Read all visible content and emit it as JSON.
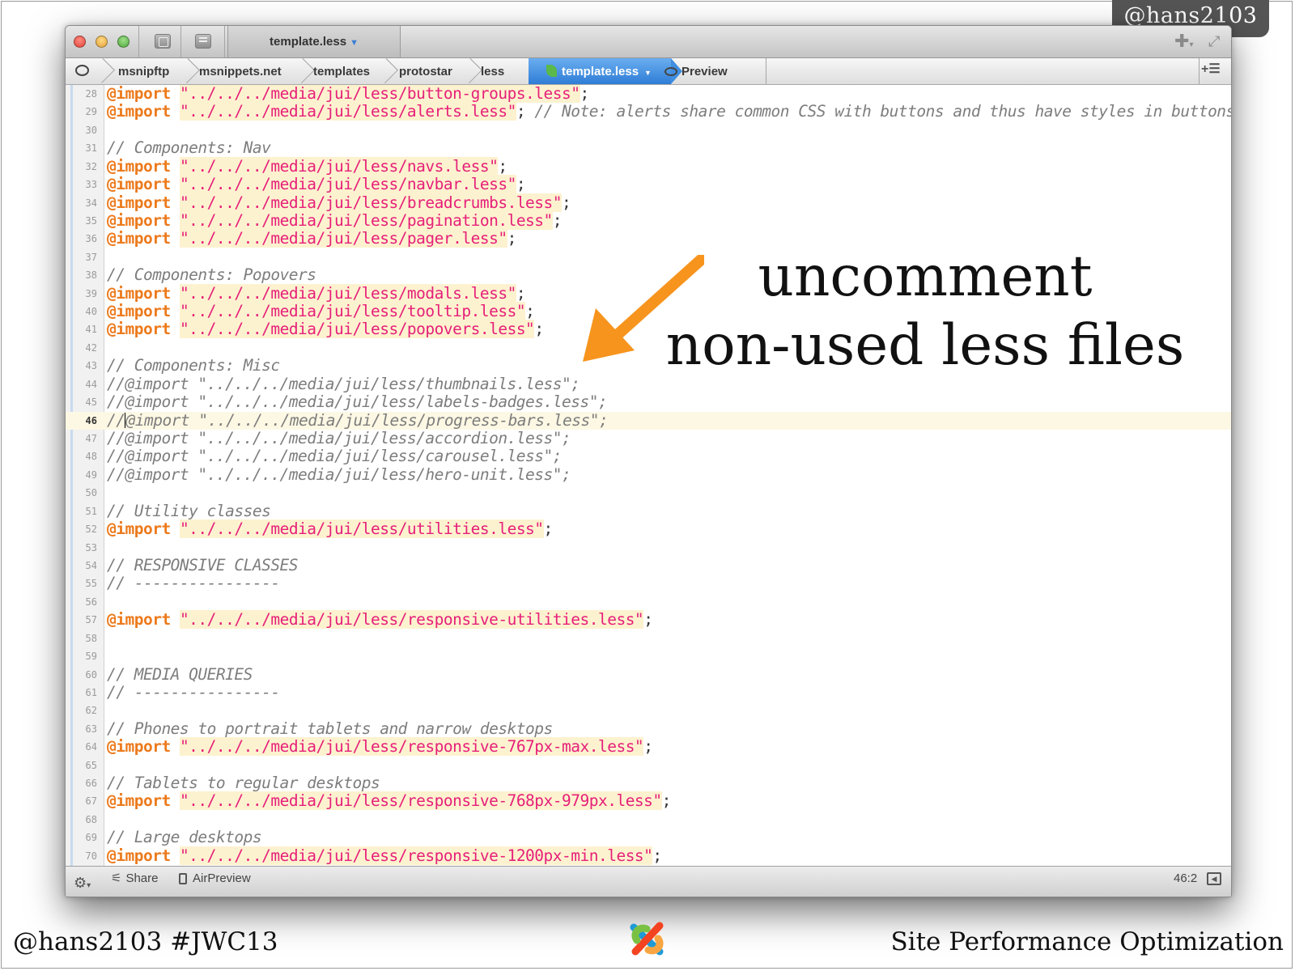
{
  "author_badge": "@hans2103",
  "window": {
    "tab_title": "template.less",
    "breadcrumbs": [
      "msnipftp",
      "msnippets.net",
      "templates",
      "protostar",
      "less"
    ],
    "active_crumb": "template.less",
    "preview_label": "Preview"
  },
  "code": {
    "current_line": 46,
    "lines": [
      {
        "n": "28",
        "kw": "@import",
        "str": "\"../../../media/jui/less/button-groups.less\"",
        "rest": ";",
        "cmt": ""
      },
      {
        "n": "29",
        "kw": "@import",
        "str": "\"../../../media/jui/less/alerts.less\"",
        "rest": "; ",
        "cmt": "// Note: alerts share common CSS with buttons and thus have styles in buttons.less"
      },
      {
        "n": "30",
        "kw": "",
        "str": "",
        "rest": "",
        "cmt": ""
      },
      {
        "n": "31",
        "kw": "",
        "str": "",
        "rest": "",
        "cmt": "// Components: Nav"
      },
      {
        "n": "32",
        "kw": "@import",
        "str": "\"../../../media/jui/less/navs.less\"",
        "rest": ";",
        "cmt": ""
      },
      {
        "n": "33",
        "kw": "@import",
        "str": "\"../../../media/jui/less/navbar.less\"",
        "rest": ";",
        "cmt": ""
      },
      {
        "n": "34",
        "kw": "@import",
        "str": "\"../../../media/jui/less/breadcrumbs.less\"",
        "rest": ";",
        "cmt": ""
      },
      {
        "n": "35",
        "kw": "@import",
        "str": "\"../../../media/jui/less/pagination.less\"",
        "rest": ";",
        "cmt": ""
      },
      {
        "n": "36",
        "kw": "@import",
        "str": "\"../../../media/jui/less/pager.less\"",
        "rest": ";",
        "cmt": ""
      },
      {
        "n": "37",
        "kw": "",
        "str": "",
        "rest": "",
        "cmt": ""
      },
      {
        "n": "38",
        "kw": "",
        "str": "",
        "rest": "",
        "cmt": "// Components: Popovers"
      },
      {
        "n": "39",
        "kw": "@import",
        "str": "\"../../../media/jui/less/modals.less\"",
        "rest": ";",
        "cmt": ""
      },
      {
        "n": "40",
        "kw": "@import",
        "str": "\"../../../media/jui/less/tooltip.less\"",
        "rest": ";",
        "cmt": ""
      },
      {
        "n": "41",
        "kw": "@import",
        "str": "\"../../../media/jui/less/popovers.less\"",
        "rest": ";",
        "cmt": ""
      },
      {
        "n": "42",
        "kw": "",
        "str": "",
        "rest": "",
        "cmt": ""
      },
      {
        "n": "43",
        "kw": "",
        "str": "",
        "rest": "",
        "cmt": "// Components: Misc"
      },
      {
        "n": "44",
        "kw": "",
        "str": "",
        "rest": "",
        "cmt": "//@import \"../../../media/jui/less/thumbnails.less\";"
      },
      {
        "n": "45",
        "kw": "",
        "str": "",
        "rest": "",
        "cmt": "//@import \"../../../media/jui/less/labels-badges.less\";"
      },
      {
        "n": "46",
        "kw": "",
        "str": "",
        "rest": "",
        "cmt": "//@import \"../../../media/jui/less/progress-bars.less\";"
      },
      {
        "n": "47",
        "kw": "",
        "str": "",
        "rest": "",
        "cmt": "//@import \"../../../media/jui/less/accordion.less\";"
      },
      {
        "n": "48",
        "kw": "",
        "str": "",
        "rest": "",
        "cmt": "//@import \"../../../media/jui/less/carousel.less\";"
      },
      {
        "n": "49",
        "kw": "",
        "str": "",
        "rest": "",
        "cmt": "//@import \"../../../media/jui/less/hero-unit.less\";"
      },
      {
        "n": "50",
        "kw": "",
        "str": "",
        "rest": "",
        "cmt": ""
      },
      {
        "n": "51",
        "kw": "",
        "str": "",
        "rest": "",
        "cmt": "// Utility classes"
      },
      {
        "n": "52",
        "kw": "@import",
        "str": "\"../../../media/jui/less/utilities.less\"",
        "rest": ";",
        "cmt": ""
      },
      {
        "n": "53",
        "kw": "",
        "str": "",
        "rest": "",
        "cmt": ""
      },
      {
        "n": "54",
        "kw": "",
        "str": "",
        "rest": "",
        "cmt": "// RESPONSIVE CLASSES"
      },
      {
        "n": "55",
        "kw": "",
        "str": "",
        "rest": "",
        "cmt": "// ----------------"
      },
      {
        "n": "56",
        "kw": "",
        "str": "",
        "rest": "",
        "cmt": ""
      },
      {
        "n": "57",
        "kw": "@import",
        "str": "\"../../../media/jui/less/responsive-utilities.less\"",
        "rest": ";",
        "cmt": ""
      },
      {
        "n": "58",
        "kw": "",
        "str": "",
        "rest": "",
        "cmt": ""
      },
      {
        "n": "59",
        "kw": "",
        "str": "",
        "rest": "",
        "cmt": ""
      },
      {
        "n": "60",
        "kw": "",
        "str": "",
        "rest": "",
        "cmt": "// MEDIA QUERIES"
      },
      {
        "n": "61",
        "kw": "",
        "str": "",
        "rest": "",
        "cmt": "// ----------------"
      },
      {
        "n": "62",
        "kw": "",
        "str": "",
        "rest": "",
        "cmt": ""
      },
      {
        "n": "63",
        "kw": "",
        "str": "",
        "rest": "",
        "cmt": "// Phones to portrait tablets and narrow desktops"
      },
      {
        "n": "64",
        "kw": "@import",
        "str": "\"../../../media/jui/less/responsive-767px-max.less\"",
        "rest": ";",
        "cmt": ""
      },
      {
        "n": "65",
        "kw": "",
        "str": "",
        "rest": "",
        "cmt": ""
      },
      {
        "n": "66",
        "kw": "",
        "str": "",
        "rest": "",
        "cmt": "// Tablets to regular desktops"
      },
      {
        "n": "67",
        "kw": "@import",
        "str": "\"../../../media/jui/less/responsive-768px-979px.less\"",
        "rest": ";",
        "cmt": ""
      },
      {
        "n": "68",
        "kw": "",
        "str": "",
        "rest": "",
        "cmt": ""
      },
      {
        "n": "69",
        "kw": "",
        "str": "",
        "rest": "",
        "cmt": "// Large desktops"
      },
      {
        "n": "70",
        "kw": "@import",
        "str": "\"../../../media/jui/less/responsive-1200px-min.less\"",
        "rest": ";",
        "cmt": ""
      }
    ]
  },
  "statusbar": {
    "share_label": "Share",
    "airpreview_label": "AirPreview",
    "cursor_position": "46:2"
  },
  "annotation": {
    "line1": "uncomment",
    "line2": "non-used less files",
    "arrow_color": "#f7941d"
  },
  "footer": {
    "left": "@hans2103 #JWC13",
    "right": "Site Performance Optimization"
  },
  "colors": {
    "keyword": "#ec7a1c",
    "string": "#e6207a",
    "comment": "#7d7d7d",
    "accent_blue": "#2f7dd6"
  }
}
